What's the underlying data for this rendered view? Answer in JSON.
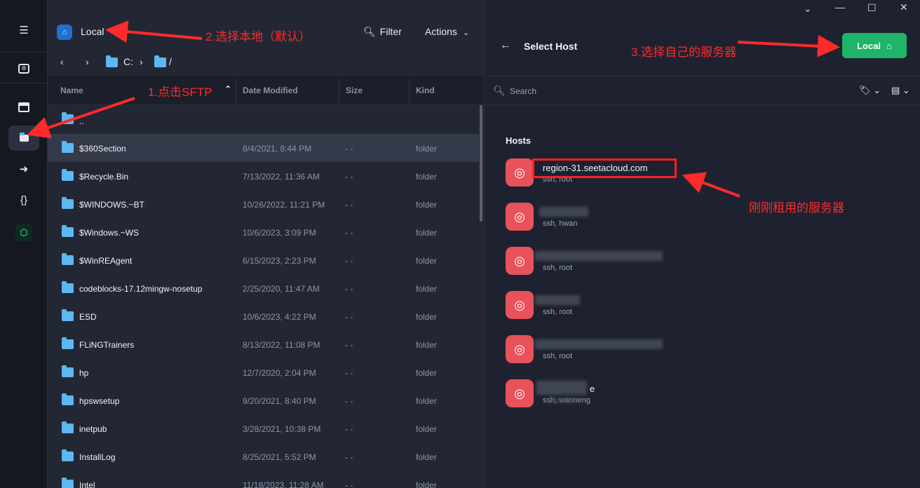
{
  "left_pane": {
    "location_label": "Local",
    "filter_label": "Filter",
    "actions_label": "Actions",
    "path_drive": "C:",
    "path_root": "/",
    "columns": [
      "Name",
      "Date Modified",
      "Size",
      "Kind"
    ],
    "parent_entry": "..",
    "files": [
      {
        "name": "$360Section",
        "date": "8/4/2021, 8:44 PM",
        "size": "- -",
        "kind": "folder"
      },
      {
        "name": "$Recycle.Bin",
        "date": "7/13/2022, 11:36 AM",
        "size": "- -",
        "kind": "folder"
      },
      {
        "name": "$WINDOWS.~BT",
        "date": "10/26/2022, 11:21 PM",
        "size": "- -",
        "kind": "folder"
      },
      {
        "name": "$Windows.~WS",
        "date": "10/6/2023, 3:09 PM",
        "size": "- -",
        "kind": "folder"
      },
      {
        "name": "$WinREAgent",
        "date": "6/15/2023, 2:23 PM",
        "size": "- -",
        "kind": "folder"
      },
      {
        "name": "codeblocks-17.12mingw-nosetup",
        "date": "2/25/2020, 11:47 AM",
        "size": "- -",
        "kind": "folder"
      },
      {
        "name": "ESD",
        "date": "10/6/2023, 4:22 PM",
        "size": "- -",
        "kind": "folder"
      },
      {
        "name": "FLiNGTrainers",
        "date": "8/13/2022, 11:08 PM",
        "size": "- -",
        "kind": "folder"
      },
      {
        "name": "hp",
        "date": "12/7/2020, 2:04 PM",
        "size": "- -",
        "kind": "folder"
      },
      {
        "name": "hpswsetup",
        "date": "9/20/2021, 8:40 PM",
        "size": "- -",
        "kind": "folder"
      },
      {
        "name": "inetpub",
        "date": "3/28/2021, 10:38 PM",
        "size": "- -",
        "kind": "folder"
      },
      {
        "name": "InstallLog",
        "date": "8/25/2021, 5:52 PM",
        "size": "- -",
        "kind": "folder"
      },
      {
        "name": "Intel",
        "date": "11/18/2023, 11:28 AM",
        "size": "- -",
        "kind": "folder"
      }
    ]
  },
  "right_pane": {
    "title": "Select Host",
    "local_button": "Local",
    "search_placeholder": "Search",
    "hosts_heading": "Hosts",
    "hosts": [
      {
        "name": "region-31.seetacloud.com",
        "sub": "ssh, root"
      },
      {
        "name": "",
        "sub": "ssh, hwan"
      },
      {
        "name": "",
        "sub": "ssh, root"
      },
      {
        "name": "",
        "sub": "ssh, root"
      },
      {
        "name": "",
        "sub": "ssh, root"
      },
      {
        "name": "e",
        "sub": "ssh, wanneng"
      }
    ]
  },
  "annotations": {
    "step1": "1.点击SFTP",
    "step2": "2.选择本地（默认）",
    "step3": "3.选择自己的服务器",
    "note": "刚刚租用的服务器",
    "color": "#ff2a2a"
  },
  "colors": {
    "accent_green": "#1fb568",
    "host_avatar": "#e8525a",
    "folder": "#5bb8f2"
  }
}
